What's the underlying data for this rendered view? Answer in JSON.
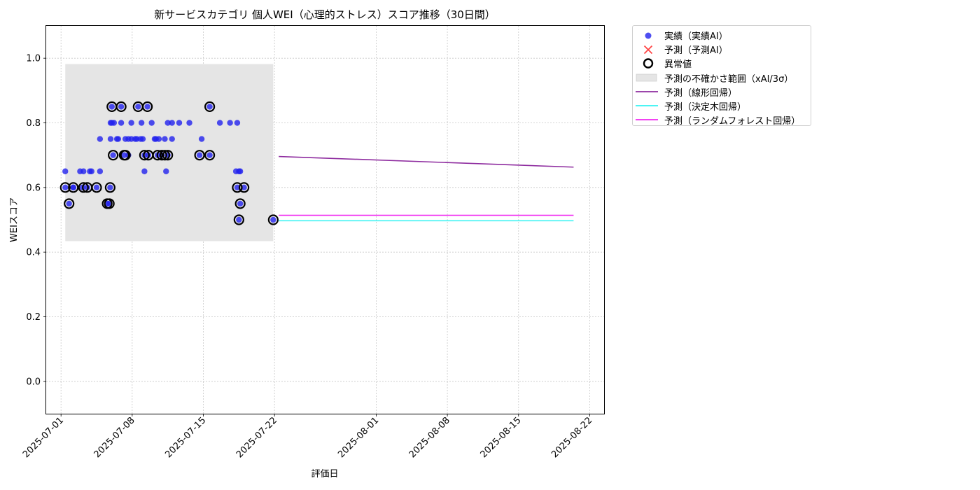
{
  "chart_data": {
    "type": "scatter",
    "title": "新サービスカテゴリ 個人WEI（心理的ストレス）スコア推移（30日間）",
    "xlabel": "評価日",
    "ylabel": "WEIスコア",
    "xlim": [
      "2025-06-29T13:00",
      "2025-08-23T10:00"
    ],
    "ylim": [
      -0.1,
      1.1
    ],
    "x_ticks": [
      "2025-07-01",
      "2025-07-08",
      "2025-07-15",
      "2025-07-22",
      "2025-08-01",
      "2025-08-08",
      "2025-08-15",
      "2025-08-22"
    ],
    "y_ticks": [
      0.0,
      0.2,
      0.4,
      0.6,
      0.8,
      1.0
    ],
    "y_tick_labels": [
      "0.0",
      "0.2",
      "0.4",
      "0.6",
      "0.8",
      "1.0"
    ],
    "grid": true,
    "legend_position": "outside-top-right",
    "colors": {
      "actual": "#2222ee",
      "predicted": "#ff4444",
      "anomaly": "#000000",
      "band": "#e5e5e5",
      "linear": "#8e2c9f",
      "tree": "#33f2f2",
      "forest": "#f028f0"
    },
    "legend": [
      {
        "key": "actual",
        "label": "実績（実績AI）",
        "symbol": "dot"
      },
      {
        "key": "predicted",
        "label": "予測（予測AI）",
        "symbol": "cross"
      },
      {
        "key": "anomaly",
        "label": "異常値",
        "symbol": "ring"
      },
      {
        "key": "band",
        "label": "予測の不確かさ範囲（xAI/3σ）",
        "symbol": "rect"
      },
      {
        "key": "linear",
        "label": "予測（線形回帰）",
        "symbol": "line"
      },
      {
        "key": "tree",
        "label": "予測（決定木回帰）",
        "symbol": "line"
      },
      {
        "key": "forest",
        "label": "予測（ランダムフォレスト回帰）",
        "symbol": "line"
      }
    ],
    "uncertainty_band": {
      "x": [
        "2025-07-01T10:00",
        "2025-07-21T21:00"
      ],
      "y": [
        0.434,
        0.982
      ]
    },
    "actual_points": [
      [
        "2025-07-01T10:00",
        0.65
      ],
      [
        "2025-07-01T10:00",
        0.6
      ],
      [
        "2025-07-01T19:00",
        0.55
      ],
      [
        "2025-07-02T05:00",
        0.6
      ],
      [
        "2025-07-02T05:00",
        0.6
      ],
      [
        "2025-07-02T21:00",
        0.65
      ],
      [
        "2025-07-03T03:00",
        0.6
      ],
      [
        "2025-07-03T05:00",
        0.65
      ],
      [
        "2025-07-03T14:00",
        0.6
      ],
      [
        "2025-07-03T20:00",
        0.65
      ],
      [
        "2025-07-04T00:00",
        0.65
      ],
      [
        "2025-07-04T12:00",
        0.6
      ],
      [
        "2025-07-04T20:00",
        0.75
      ],
      [
        "2025-07-04T20:00",
        0.65
      ],
      [
        "2025-07-05T13:00",
        0.55
      ],
      [
        "2025-07-05T18:00",
        0.55
      ],
      [
        "2025-07-05T20:00",
        0.6
      ],
      [
        "2025-07-05T21:00",
        0.8
      ],
      [
        "2025-07-05T21:00",
        0.75
      ],
      [
        "2025-07-06T00:00",
        0.8
      ],
      [
        "2025-07-06T00:00",
        0.85
      ],
      [
        "2025-07-06T03:00",
        0.7
      ],
      [
        "2025-07-06T05:00",
        0.8
      ],
      [
        "2025-07-06T12:00",
        0.75
      ],
      [
        "2025-07-06T15:00",
        0.75
      ],
      [
        "2025-07-06T22:00",
        0.8
      ],
      [
        "2025-07-06T22:00",
        0.85
      ],
      [
        "2025-07-07T05:00",
        0.7
      ],
      [
        "2025-07-07T08:00",
        0.75
      ],
      [
        "2025-07-07T15:00",
        0.7
      ],
      [
        "2025-07-07T15:00",
        0.75
      ],
      [
        "2025-07-07T22:00",
        0.75
      ],
      [
        "2025-07-07T22:00",
        0.8
      ],
      [
        "2025-07-08T07:00",
        0.75
      ],
      [
        "2025-07-08T11:00",
        0.75
      ],
      [
        "2025-07-08T14:00",
        0.85
      ],
      [
        "2025-07-08T20:00",
        0.75
      ],
      [
        "2025-07-08T22:00",
        0.8
      ],
      [
        "2025-07-09T01:00",
        0.75
      ],
      [
        "2025-07-09T05:00",
        0.7
      ],
      [
        "2025-07-09T05:00",
        0.65
      ],
      [
        "2025-07-09T12:00",
        0.85
      ],
      [
        "2025-07-09T14:00",
        0.7
      ],
      [
        "2025-07-09T22:00",
        0.8
      ],
      [
        "2025-07-10T05:00",
        0.75
      ],
      [
        "2025-07-10T08:00",
        0.75
      ],
      [
        "2025-07-10T12:00",
        0.7
      ],
      [
        "2025-07-10T15:00",
        0.75
      ],
      [
        "2025-07-10T22:00",
        0.7
      ],
      [
        "2025-07-11T05:00",
        0.75
      ],
      [
        "2025-07-11T08:00",
        0.65
      ],
      [
        "2025-07-11T12:00",
        0.7
      ],
      [
        "2025-07-11T12:00",
        0.8
      ],
      [
        "2025-07-11T22:00",
        0.8
      ],
      [
        "2025-07-11T22:00",
        0.75
      ],
      [
        "2025-07-12T15:00",
        0.8
      ],
      [
        "2025-07-13T15:00",
        0.8
      ],
      [
        "2025-07-14T15:00",
        0.7
      ],
      [
        "2025-07-14T20:00",
        0.75
      ],
      [
        "2025-07-15T15:00",
        0.85
      ],
      [
        "2025-07-15T15:00",
        0.7
      ],
      [
        "2025-07-16T15:00",
        0.8
      ],
      [
        "2025-07-17T15:00",
        0.8
      ],
      [
        "2025-07-18T05:00",
        0.65
      ],
      [
        "2025-07-18T08:00",
        0.6
      ],
      [
        "2025-07-18T08:00",
        0.8
      ],
      [
        "2025-07-18T12:00",
        0.5
      ],
      [
        "2025-07-18T12:00",
        0.65
      ],
      [
        "2025-07-18T15:00",
        0.65
      ],
      [
        "2025-07-18T15:00",
        0.55
      ],
      [
        "2025-07-19T00:00",
        0.6
      ],
      [
        "2025-07-21T21:00",
        0.5
      ]
    ],
    "anomaly_points": [
      [
        "2025-07-01T10:00",
        0.6
      ],
      [
        "2025-07-01T19:00",
        0.55
      ],
      [
        "2025-07-02T05:00",
        0.6
      ],
      [
        "2025-07-03T05:00",
        0.6
      ],
      [
        "2025-07-03T14:00",
        0.6
      ],
      [
        "2025-07-04T12:00",
        0.6
      ],
      [
        "2025-07-05T13:00",
        0.55
      ],
      [
        "2025-07-05T18:00",
        0.55
      ],
      [
        "2025-07-05T20:00",
        0.6
      ],
      [
        "2025-07-06T00:00",
        0.85
      ],
      [
        "2025-07-06T03:00",
        0.7
      ],
      [
        "2025-07-06T22:00",
        0.85
      ],
      [
        "2025-07-07T05:00",
        0.7
      ],
      [
        "2025-07-07T08:00",
        0.7
      ],
      [
        "2025-07-08T14:00",
        0.85
      ],
      [
        "2025-07-09T05:00",
        0.7
      ],
      [
        "2025-07-09T12:00",
        0.85
      ],
      [
        "2025-07-09T14:00",
        0.7
      ],
      [
        "2025-07-10T12:00",
        0.7
      ],
      [
        "2025-07-10T22:00",
        0.7
      ],
      [
        "2025-07-11T05:00",
        0.7
      ],
      [
        "2025-07-11T12:00",
        0.7
      ],
      [
        "2025-07-14T15:00",
        0.7
      ],
      [
        "2025-07-15T15:00",
        0.85
      ],
      [
        "2025-07-15T15:00",
        0.7
      ],
      [
        "2025-07-18T08:00",
        0.6
      ],
      [
        "2025-07-18T12:00",
        0.5
      ],
      [
        "2025-07-18T15:00",
        0.55
      ],
      [
        "2025-07-19T00:00",
        0.6
      ],
      [
        "2025-07-21T21:00",
        0.5
      ]
    ],
    "prediction_lines": [
      {
        "key": "linear",
        "x": [
          "2025-07-22T10:00",
          "2025-08-20T10:00"
        ],
        "y": [
          0.696,
          0.663
        ]
      },
      {
        "key": "tree",
        "x": [
          "2025-07-22T10:00",
          "2025-08-20T10:00"
        ],
        "y": [
          0.497,
          0.497
        ]
      },
      {
        "key": "forest",
        "x": [
          "2025-07-22T10:00",
          "2025-08-20T10:00"
        ],
        "y": [
          0.514,
          0.514
        ]
      }
    ]
  }
}
